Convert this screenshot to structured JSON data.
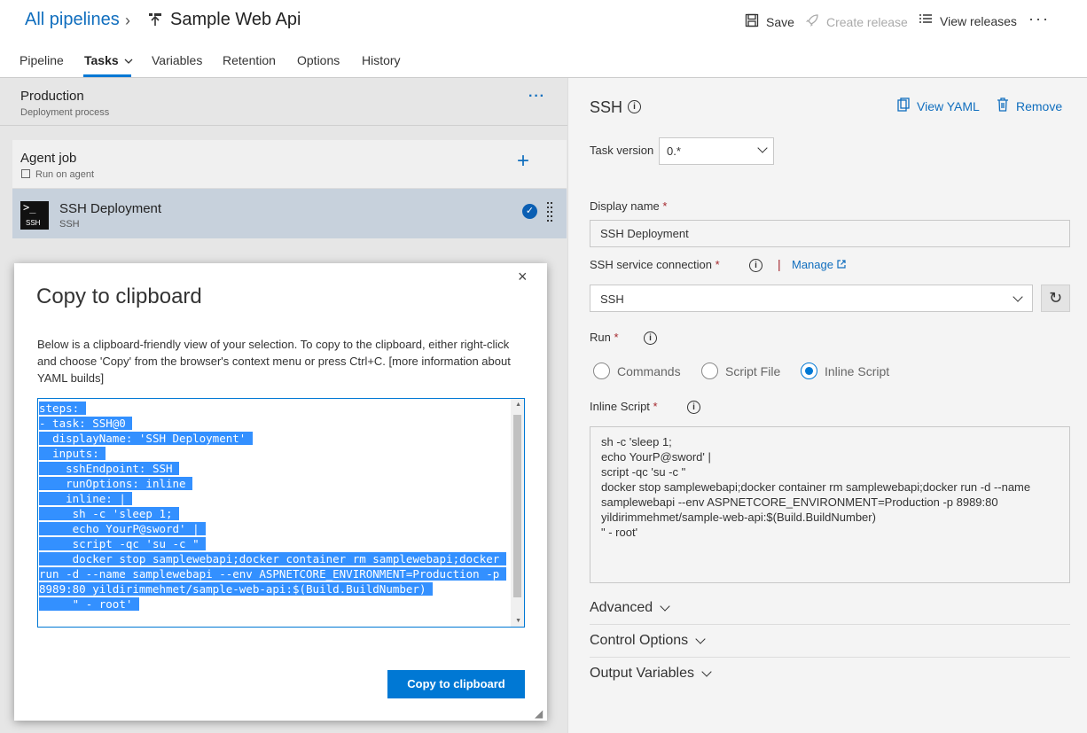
{
  "breadcrumb": {
    "root": "All pipelines",
    "separator": "›",
    "title": "Sample Web Api"
  },
  "toolbar": {
    "save": "Save",
    "create_release": "Create release",
    "view_releases": "View releases",
    "more": "···"
  },
  "tabs": [
    {
      "label": "Pipeline"
    },
    {
      "label": "Tasks"
    },
    {
      "label": "Variables"
    },
    {
      "label": "Retention"
    },
    {
      "label": "Options"
    },
    {
      "label": "History"
    }
  ],
  "stage": {
    "title": "Production",
    "subtitle": "Deployment process",
    "more": "···"
  },
  "agent_job": {
    "title": "Agent job",
    "subtitle": "Run on agent",
    "add": "+"
  },
  "task": {
    "title": "SSH Deployment",
    "subtitle": "SSH",
    "icon_text": "SSH",
    "prompt": ">_"
  },
  "dialog": {
    "title": "Copy to clipboard",
    "close": "×",
    "description": "Below is a clipboard-friendly view of your selection. To copy to the clipboard, either right-click and choose 'Copy' from the browser's context menu or press Ctrl+C. [more information about YAML builds]",
    "yaml_lines": [
      "steps:",
      "- task: SSH@0",
      "  displayName: 'SSH Deployment'",
      "  inputs:",
      "    sshEndpoint: SSH",
      "    runOptions: inline",
      "    inline: |",
      "     sh -c 'sleep 1;",
      "     echo YourP@sword' |",
      "     script -qc 'su -c \"",
      "     docker stop samplewebapi;docker container rm samplewebapi;docker run -d --name samplewebapi --env ASPNETCORE_ENVIRONMENT=Production -p 8989:80 yildirimmehmet/sample-web-api:$(Build.BuildNumber)",
      "     \" - root'"
    ],
    "copy_button": "Copy to clipboard"
  },
  "task_panel": {
    "title": "SSH",
    "view_yaml": "View YAML",
    "remove": "Remove",
    "task_version_label": "Task version",
    "task_version_value": "0.*",
    "display_name_label": "Display name",
    "display_name_value": "SSH Deployment",
    "ssh_connection_label": "SSH service connection",
    "manage_link": "Manage",
    "ssh_connection_value": "SSH",
    "run_label": "Run",
    "run_options": [
      "Commands",
      "Script File",
      "Inline Script"
    ],
    "run_selected": "Inline Script",
    "inline_script_label": "Inline Script",
    "inline_script_value": "sh -c 'sleep 1;\necho YourP@sword' |\nscript -qc 'su -c \"\ndocker stop samplewebapi;docker container rm samplewebapi;docker run -d --name samplewebapi --env ASPNETCORE_ENVIRONMENT=Production -p 8989:80 yildirimmehmet/sample-web-api:$(Build.BuildNumber)\n\" - root'",
    "required_mark": "*",
    "sections": [
      "Advanced",
      "Control Options",
      "Output Variables"
    ]
  },
  "colors": {
    "accent": "#0078d4",
    "link": "#106ebe",
    "selection": "#3390ff",
    "required": "#a4262c"
  }
}
